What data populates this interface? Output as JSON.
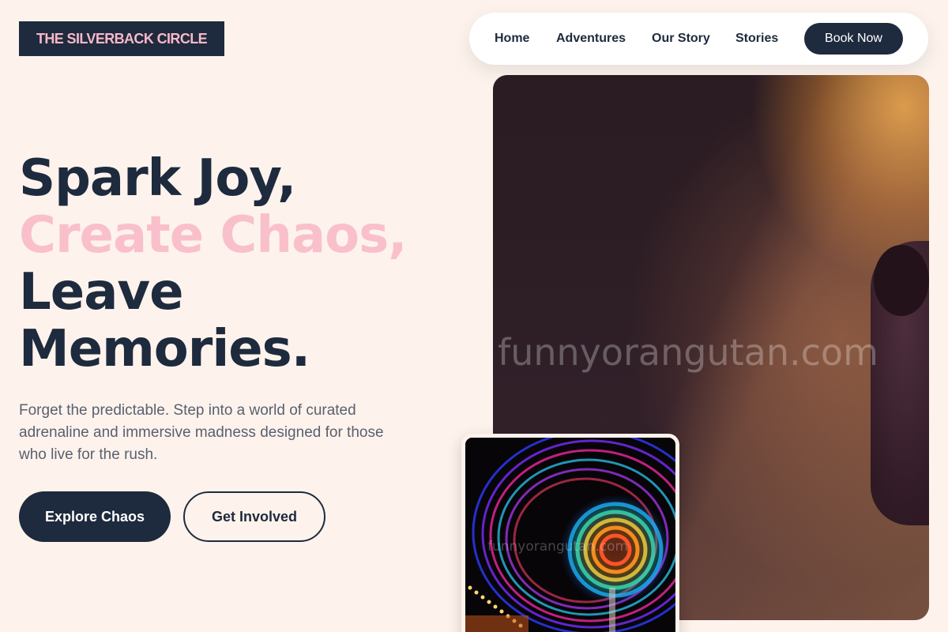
{
  "brand": {
    "name": "THE SILVERBACK CIRCLE"
  },
  "nav": {
    "items": [
      {
        "label": "Home"
      },
      {
        "label": "Adventures"
      },
      {
        "label": "Our Story"
      },
      {
        "label": "Stories"
      }
    ],
    "cta_label": "Book Now"
  },
  "hero": {
    "title_line1": "Spark Joy,",
    "title_line2": "Create Chaos,",
    "title_line3": "Leave",
    "title_line4": "Memories.",
    "description": "Forget the predictable. Step into a world of curated adrenaline and immersive madness designed for those who live for the rush.",
    "primary_button": "Explore Chaos",
    "secondary_button": "Get Involved"
  },
  "images": {
    "main_watermark": "funnyorangutan.com",
    "small_watermark": "funnyorangutan.com"
  },
  "colors": {
    "background": "#fdf3ec",
    "navy": "#1e2a3d",
    "pink_accent": "#f9c0cc",
    "body_text": "#5a6070"
  }
}
